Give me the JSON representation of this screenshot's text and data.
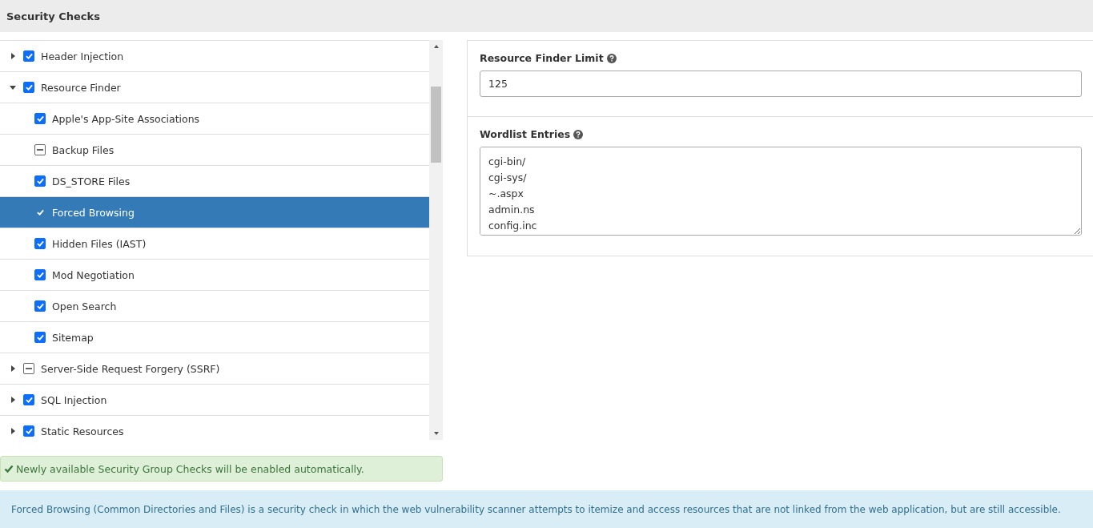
{
  "header": {
    "title": "Security Checks"
  },
  "checks": [
    {
      "label": "Header Injection",
      "expanded": false,
      "checked": true,
      "indeterminate": false,
      "selected": false
    },
    {
      "label": "Resource Finder",
      "expanded": true,
      "checked": true,
      "indeterminate": false,
      "selected": false,
      "children": [
        {
          "label": "Apple's App-Site Associations",
          "checked": true,
          "indeterminate": false,
          "selected": false
        },
        {
          "label": "Backup Files",
          "checked": false,
          "indeterminate": true,
          "selected": false
        },
        {
          "label": "DS_STORE Files",
          "checked": true,
          "indeterminate": false,
          "selected": false
        },
        {
          "label": "Forced Browsing",
          "checked": true,
          "indeterminate": false,
          "selected": true
        },
        {
          "label": "Hidden Files (IAST)",
          "checked": true,
          "indeterminate": false,
          "selected": false
        },
        {
          "label": "Mod Negotiation",
          "checked": true,
          "indeterminate": false,
          "selected": false
        },
        {
          "label": "Open Search",
          "checked": true,
          "indeterminate": false,
          "selected": false
        },
        {
          "label": "Sitemap",
          "checked": true,
          "indeterminate": false,
          "selected": false
        }
      ]
    },
    {
      "label": "Server-Side Request Forgery (SSRF)",
      "expanded": false,
      "checked": false,
      "indeterminate": true,
      "selected": false
    },
    {
      "label": "SQL Injection",
      "expanded": false,
      "checked": true,
      "indeterminate": false,
      "selected": false
    },
    {
      "label": "Static Resources",
      "expanded": false,
      "checked": true,
      "indeterminate": false,
      "selected": false
    }
  ],
  "alert": "Newly available Security Group Checks will be enabled automatically.",
  "settings": {
    "limit": {
      "label": "Resource Finder Limit",
      "value": "125"
    },
    "wordlist": {
      "label": "Wordlist Entries",
      "lines": [
        "cgi-bin/",
        "cgi-sys/",
        "~.aspx",
        "admin.ns",
        "config.inc"
      ]
    }
  },
  "description": "Forced Browsing (Common Directories and Files) is a security check in which the web vulnerability scanner attempts to itemize and access resources that are not linked from the web application, but are still accessible."
}
